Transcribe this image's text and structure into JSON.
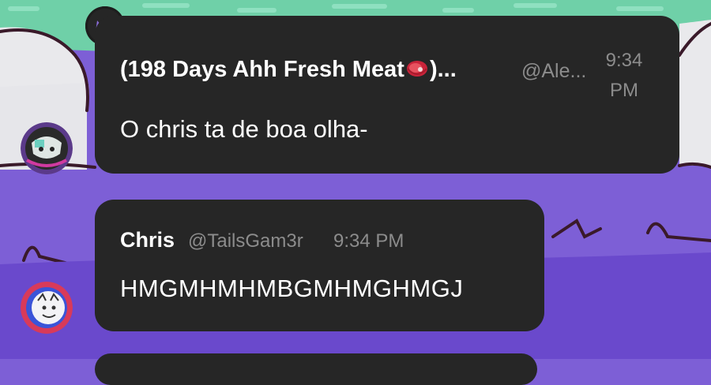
{
  "messages": [
    {
      "author_prefix": "(198 Days Ahh Fresh Meat",
      "author_suffix": ")...",
      "author_emoji": "meat-emoji",
      "handle": "@Ale...",
      "time": "9:34 PM",
      "text": "O chris ta de boa olha-",
      "badge": "crown-icon"
    },
    {
      "author": "Chris",
      "handle": "@TailsGam3r",
      "time": "9:34 PM",
      "text": "HMGMHMHMBGMHMGHMGJ"
    }
  ],
  "colors": {
    "bubble": "#262626",
    "muted_text": "#8c8c8c",
    "crown": "#8a6cd8",
    "background_purple": "#7d5fd6",
    "background_green": "#6fd0a8"
  }
}
